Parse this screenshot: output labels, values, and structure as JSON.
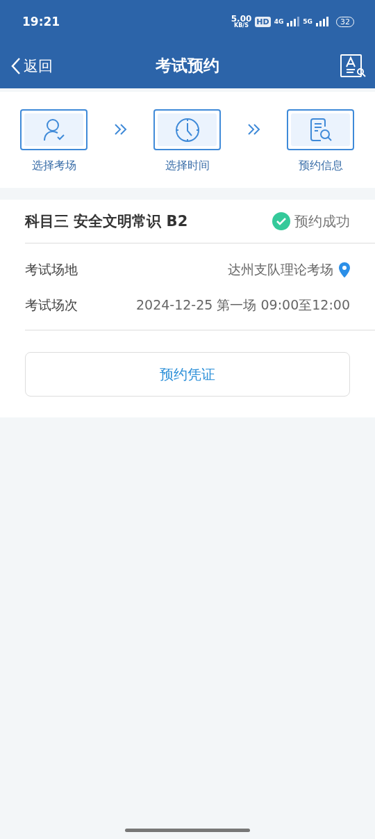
{
  "status_bar": {
    "time": "19:21",
    "speed": "5.00",
    "speed_unit": "KB/S",
    "hd": "HD",
    "net_1": "4G",
    "net_2": "5G",
    "battery": "32"
  },
  "nav": {
    "back": "返回",
    "title": "考试预约"
  },
  "steps": [
    {
      "label": "选择考场",
      "kind": "person"
    },
    {
      "label": "选择时间",
      "kind": "clock"
    },
    {
      "label": "预约信息",
      "kind": "document"
    }
  ],
  "card": {
    "subject": "科目三 安全文明常识 B2",
    "status": "预约成功",
    "success": true,
    "rows": [
      {
        "label": "考试场地",
        "value": "达州支队理论考场",
        "kind": "location"
      },
      {
        "label": "考试场次",
        "value": "2024-12-25 第一场 09:00至12:00",
        "kind": "text"
      }
    ],
    "button": "预约凭证"
  }
}
